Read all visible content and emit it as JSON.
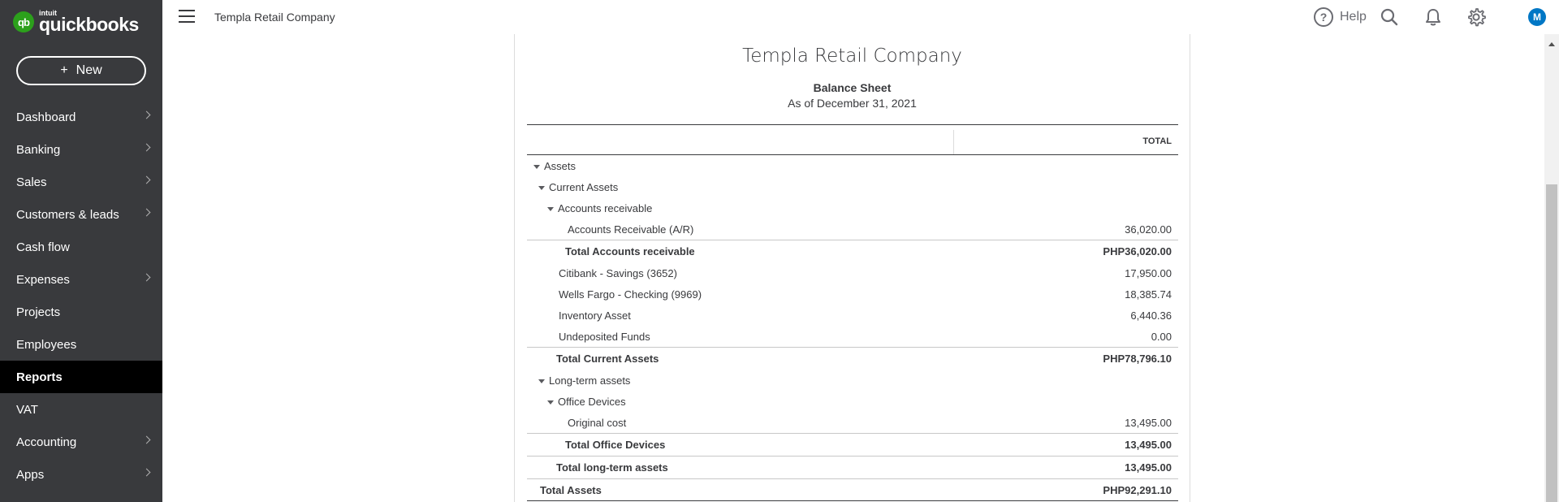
{
  "app": {
    "brand_small": "intuit",
    "brand_name": "quickbooks",
    "logo_mark": "qb"
  },
  "sidebar": {
    "new_button": {
      "icon": "+",
      "label": "New"
    },
    "items": [
      {
        "label": "Dashboard",
        "has_chevron": true
      },
      {
        "label": "Banking",
        "has_chevron": true
      },
      {
        "label": "Sales",
        "has_chevron": true
      },
      {
        "label": "Customers & leads",
        "has_chevron": true
      },
      {
        "label": "Cash flow",
        "has_chevron": false
      },
      {
        "label": "Expenses",
        "has_chevron": true
      },
      {
        "label": "Projects",
        "has_chevron": false
      },
      {
        "label": "Employees",
        "has_chevron": false
      },
      {
        "label": "Reports",
        "has_chevron": false,
        "active": true
      },
      {
        "label": "VAT",
        "has_chevron": false
      },
      {
        "label": "Accounting",
        "has_chevron": true
      },
      {
        "label": "Apps",
        "has_chevron": true
      }
    ]
  },
  "topbar": {
    "company_name": "Templa Retail Company",
    "help_icon": "?",
    "help_label": "Help",
    "icons": [
      "search-icon",
      "bell-icon",
      "gear-icon"
    ],
    "avatar_initial": "M"
  },
  "report": {
    "company": "Templa Retail Company",
    "title": "Balance Sheet",
    "date": "As of December 31, 2021",
    "column_header": "TOTAL",
    "rows": [
      {
        "label": "Assets",
        "value": "",
        "kind": "section",
        "level": 0
      },
      {
        "label": "Current Assets",
        "value": "",
        "kind": "section",
        "level": 1
      },
      {
        "label": "Accounts receivable",
        "value": "",
        "kind": "section",
        "level": 2
      },
      {
        "label": "Accounts Receivable (A/R)",
        "value": "36,020.00",
        "kind": "line",
        "level": 3
      },
      {
        "label": "Total Accounts receivable",
        "value": "PHP36,020.00",
        "kind": "total",
        "level": 3
      },
      {
        "label": "Citibank - Savings (3652)",
        "value": "17,950.00",
        "kind": "line",
        "level": 2
      },
      {
        "label": "Wells Fargo - Checking (9969)",
        "value": "18,385.74",
        "kind": "line",
        "level": 2
      },
      {
        "label": "Inventory Asset",
        "value": "6,440.36",
        "kind": "line",
        "level": 2
      },
      {
        "label": "Undeposited Funds",
        "value": "0.00",
        "kind": "line",
        "level": 2
      },
      {
        "label": "Total Current Assets",
        "value": "PHP78,796.10",
        "kind": "total",
        "level": 2
      },
      {
        "label": "Long-term assets",
        "value": "",
        "kind": "section",
        "level": 1
      },
      {
        "label": "Office Devices",
        "value": "",
        "kind": "section",
        "level": 2
      },
      {
        "label": "Original cost",
        "value": "13,495.00",
        "kind": "line",
        "level": 3
      },
      {
        "label": "Total Office Devices",
        "value": "13,495.00",
        "kind": "total",
        "level": 3
      },
      {
        "label": "Total long-term assets",
        "value": "13,495.00",
        "kind": "total",
        "level": 2
      },
      {
        "label": "Total Assets",
        "value": "PHP92,291.10",
        "kind": "grand",
        "level": 1
      }
    ]
  },
  "colors": {
    "sidebar_bg": "#393a3d",
    "active_nav_bg": "#000000",
    "brand_green": "#2ca01c",
    "avatar_blue": "#0077c5",
    "text": "#393a3d"
  }
}
